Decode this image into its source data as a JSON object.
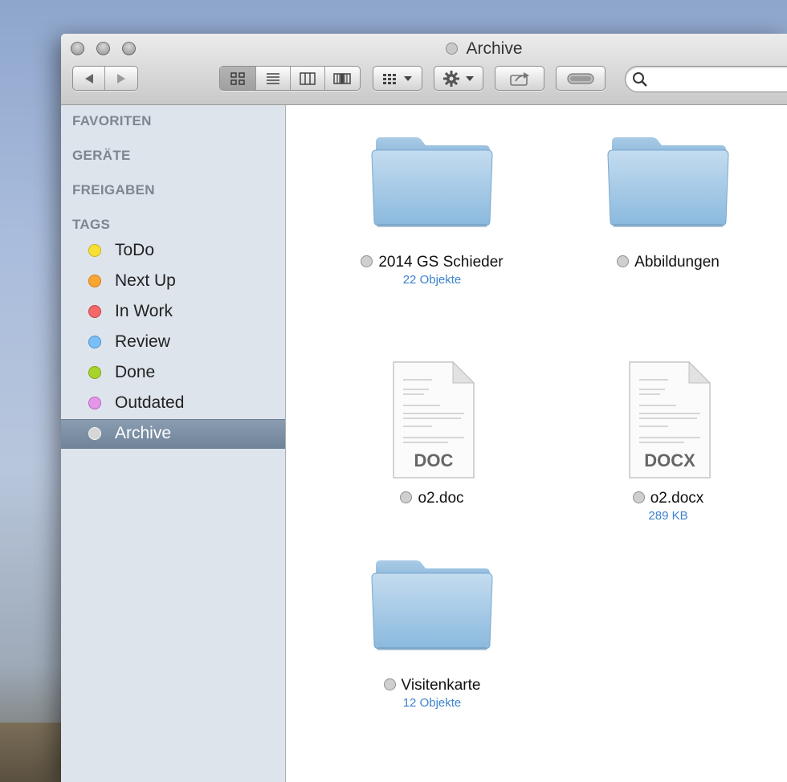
{
  "window": {
    "title": "Archive"
  },
  "toolbar": {
    "back_icon": "back-arrow-icon",
    "forward_icon": "forward-arrow-icon",
    "view_modes": [
      "icon-view-icon",
      "list-view-icon",
      "column-view-icon",
      "cover-flow-icon"
    ],
    "active_view": "icon-view-icon",
    "arrange_icon": "arrange-grid-icon",
    "action_icon": "gear-icon",
    "share_icon": "share-icon",
    "tags_icon": "tag-toggle-icon",
    "search_placeholder": ""
  },
  "sidebar": {
    "sections": {
      "favorites": "FAVORITEN",
      "devices": "GERÄTE",
      "shared": "FREIGABEN",
      "tags": "TAGS"
    },
    "tags": [
      {
        "label": "ToDo",
        "color": "#f6e034"
      },
      {
        "label": "Next Up",
        "color": "#f9a534"
      },
      {
        "label": "In Work",
        "color": "#f4686a"
      },
      {
        "label": "Review",
        "color": "#7cbff6"
      },
      {
        "label": "Done",
        "color": "#a8d42a"
      },
      {
        "label": "Outdated",
        "color": "#e596ea"
      },
      {
        "label": "Archive",
        "color": "#d6d6d6"
      }
    ],
    "selected_tag": "Archive"
  },
  "items": [
    {
      "name": "2014 GS Schieder",
      "sub": "22 Objekte",
      "kind": "folder"
    },
    {
      "name": "Abbildungen",
      "sub": "",
      "kind": "folder"
    },
    {
      "name": "o2.doc",
      "sub": "",
      "kind": "document",
      "badge": "DOC"
    },
    {
      "name": "o2.docx",
      "sub": "289 KB",
      "kind": "document",
      "badge": "DOCX"
    },
    {
      "name": "Visitenkarte",
      "sub": "12 Objekte",
      "kind": "folder"
    }
  ]
}
